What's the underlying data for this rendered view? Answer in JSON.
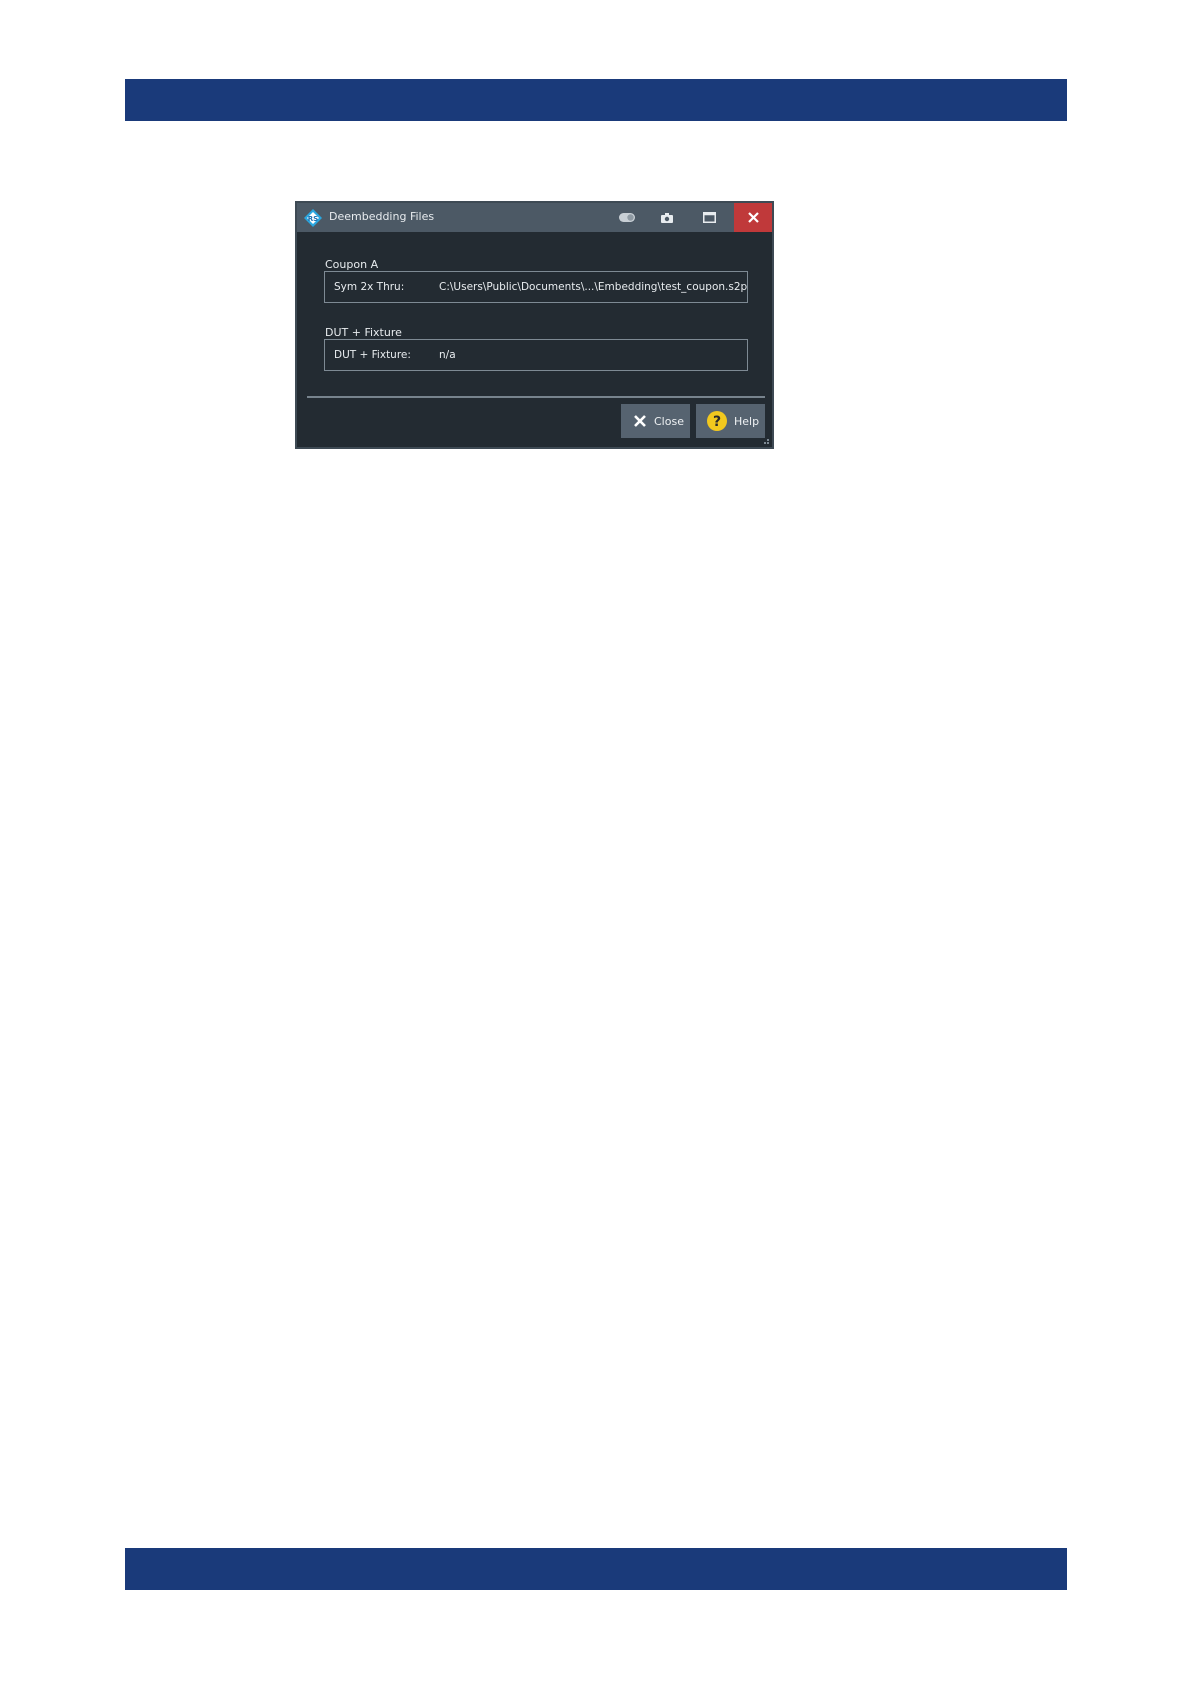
{
  "dialog": {
    "title": "Deembedding Files",
    "icons": {
      "app": "rohde-schwarz-logo-icon",
      "toggle": "toggle-switch-icon",
      "camera": "camera-icon",
      "maximize": "maximize-icon",
      "close": "close-icon"
    },
    "groups": [
      {
        "label": "Coupon A",
        "field_label": "Sym 2x Thru:",
        "field_value": "C:\\Users\\Public\\Documents\\...\\Embedding\\test_coupon.s2p"
      },
      {
        "label": "DUT + Fixture",
        "field_label": "DUT + Fixture:",
        "field_value": "n/a"
      }
    ],
    "buttons": {
      "close_label": "Close",
      "help_label": "Help"
    }
  },
  "colors": {
    "page_band": "#1a3a7a",
    "dialog_bg": "#232b32",
    "titlebar_bg": "#4c5965",
    "close_red": "#c0393a",
    "help_yellow": "#f2c81e"
  }
}
